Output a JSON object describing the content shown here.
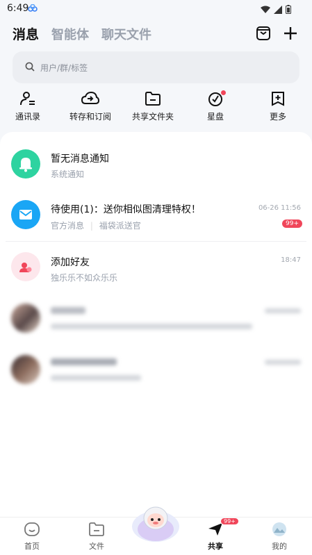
{
  "status": {
    "time": "6:49"
  },
  "tabs": [
    {
      "label": "消息"
    },
    {
      "label": "智能体"
    },
    {
      "label": "聊天文件"
    }
  ],
  "search": {
    "placeholder": "用户/群/标签"
  },
  "shortcuts": [
    {
      "label": "通讯录",
      "icon": "contacts-icon"
    },
    {
      "label": "转存和订阅",
      "icon": "cloud-transfer-icon"
    },
    {
      "label": "共享文件夹",
      "icon": "shared-folder-icon"
    },
    {
      "label": "星盘",
      "icon": "star-disk-icon",
      "dot": true
    },
    {
      "label": "更多",
      "icon": "more-icon"
    }
  ],
  "messages": [
    {
      "title": "暂无消息通知",
      "subtitle": "系统通知",
      "time": "",
      "avatar_color": "#2ed3a0"
    },
    {
      "title": "待使用(1)：送你相似图清理特权！",
      "subtitle_a": "官方消息",
      "subtitle_b": "福袋派送官",
      "time": "06-26 11:56",
      "badge": "99+",
      "avatar_color": "#1aa6f5"
    },
    {
      "title": "添加好友",
      "subtitle": "独乐乐不如众乐乐",
      "time": "18:47",
      "avatar_color": "#fde7ec"
    }
  ],
  "bottom_nav": [
    {
      "label": "首页",
      "icon": "home-icon"
    },
    {
      "label": "文件",
      "icon": "folder-icon"
    },
    {
      "label": "共享",
      "icon": "share-send-icon",
      "badge": "99+"
    },
    {
      "label": "我的",
      "icon": "profile-icon"
    }
  ],
  "colors": {
    "accent": "#1aa6f5",
    "red": "#f0465a",
    "green": "#2ed3a0"
  }
}
